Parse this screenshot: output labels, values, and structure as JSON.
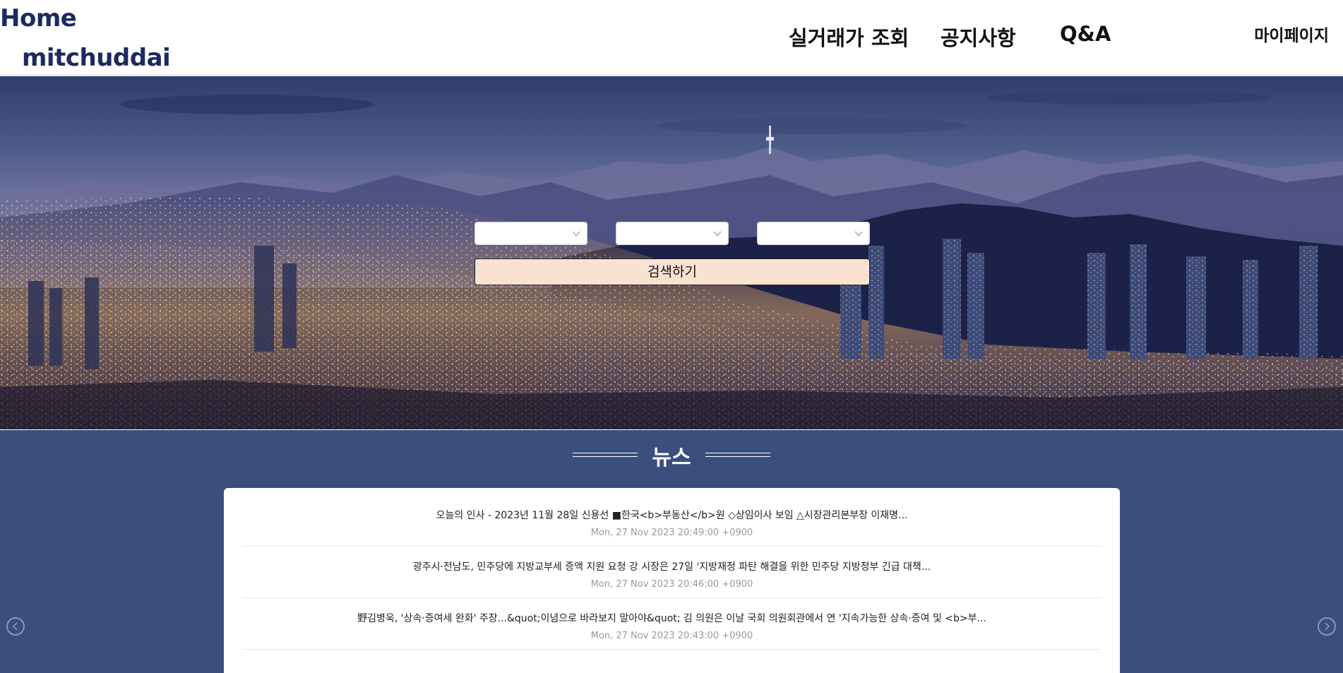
{
  "header": {
    "logo_home": "Home",
    "logo_sub": "mitchuddai",
    "nav": [
      "실거래가 조회",
      "공지사항",
      "Q&A"
    ],
    "mypage": "마이페이지"
  },
  "search": {
    "selects": [
      "",
      "",
      ""
    ],
    "button_label": "검색하기"
  },
  "news": {
    "title": "뉴스",
    "items": [
      {
        "title": "오늘의 인사 - 2023년 11월 28일 신용선 ■한국<b>부동산</b>원 ◇상임이사 보임 △시장관리본부장 이재명...",
        "date": "Mon, 27 Nov 2023 20:49:00 +0900"
      },
      {
        "title": "광주시·전남도, 민주당에 지방교부세 증액 지원 요청 강 시장은 27일 '지방재정 파탄 해결을 위한 민주당 지방정부 긴급 대책...",
        "date": "Mon, 27 Nov 2023 20:46:00 +0900"
      },
      {
        "title": "野김병욱, '상속·증여세 완화' 주장...&quot;이념으로 바라보지 말아야&quot; 김 의원은 이날 국회 의원회관에서 연 '지속가능한 상속·증여 및 <b>부...",
        "date": "Mon, 27 Nov 2023 20:43:00 +0900"
      }
    ]
  },
  "colors": {
    "brand": "#1c2a5e",
    "news_bg": "#3b4f7f",
    "button_bg": "#fae2d3"
  }
}
